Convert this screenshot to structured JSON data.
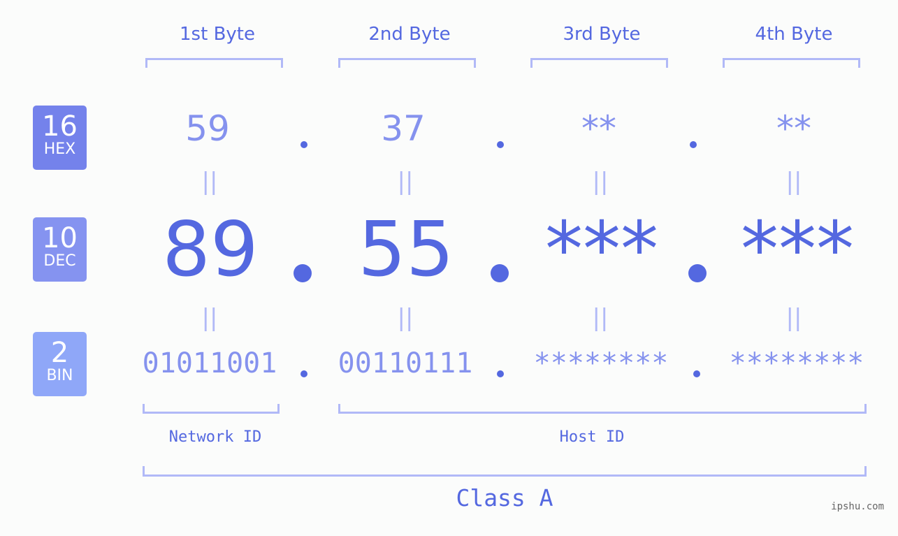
{
  "columns": [
    "1st Byte",
    "2nd Byte",
    "3rd Byte",
    "4th Byte"
  ],
  "bases": [
    {
      "number": "16",
      "label": "HEX",
      "color": "#7482eb"
    },
    {
      "number": "10",
      "label": "DEC",
      "color": "#8593f0"
    },
    {
      "number": "2",
      "label": "BIN",
      "color": "#8fa7f8"
    }
  ],
  "hex": [
    "59",
    "37",
    "**",
    "**"
  ],
  "dec": [
    "89",
    "55",
    "***",
    "***"
  ],
  "bin": [
    "01011001",
    "00110111",
    "********",
    "********"
  ],
  "equals_symbol": "||",
  "network_label": "Network ID",
  "host_label": "Host ID",
  "class_label": "Class A",
  "watermark": "ipshu.com",
  "colors": {
    "accent": "#5468e0",
    "light": "#8592ee",
    "bracket": "#b1b9f7",
    "background": "#fbfcfb"
  }
}
